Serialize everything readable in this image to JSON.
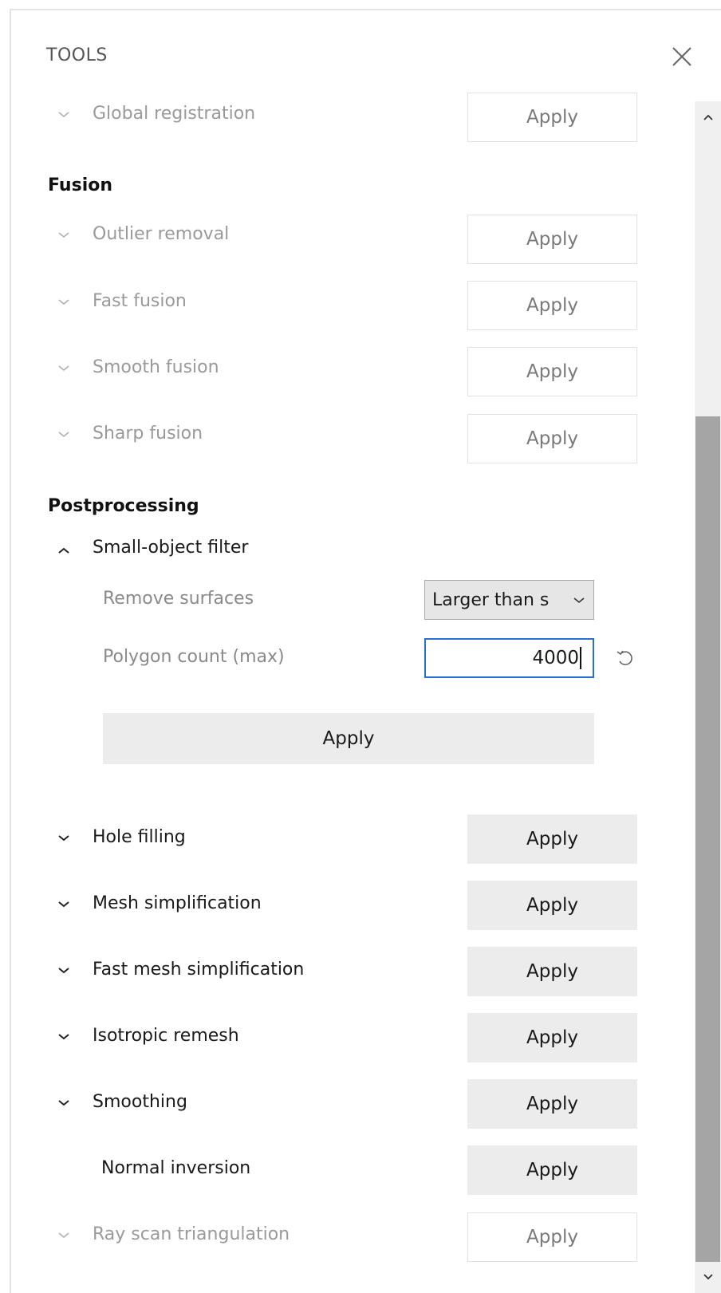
{
  "header": {
    "title": "TOOLS",
    "close_icon": "close-icon"
  },
  "registration": {
    "items": [
      {
        "label": "Global registration",
        "apply": "Apply"
      }
    ]
  },
  "fusion": {
    "title": "Fusion",
    "items": [
      {
        "label": "Outlier removal",
        "apply": "Apply"
      },
      {
        "label": "Fast fusion",
        "apply": "Apply"
      },
      {
        "label": "Smooth fusion",
        "apply": "Apply"
      },
      {
        "label": "Sharp fusion",
        "apply": "Apply"
      }
    ]
  },
  "postprocessing": {
    "title": "Postprocessing",
    "small_object_filter": {
      "label": "Small-object filter",
      "remove_surfaces_label": "Remove surfaces",
      "remove_surfaces_value": "Larger than s",
      "polygon_count_label": "Polygon count (max)",
      "polygon_count_value": "4000",
      "apply": "Apply"
    },
    "items": [
      {
        "label": "Hole filling",
        "apply": "Apply"
      },
      {
        "label": "Mesh simplification",
        "apply": "Apply"
      },
      {
        "label": "Fast mesh simplification",
        "apply": "Apply"
      },
      {
        "label": "Isotropic remesh",
        "apply": "Apply"
      },
      {
        "label": "Smoothing",
        "apply": "Apply"
      },
      {
        "label": "Normal inversion",
        "apply": "Apply"
      },
      {
        "label": "Ray scan triangulation",
        "apply": "Apply"
      }
    ]
  },
  "colors": {
    "accent": "#2a6fd6",
    "disabled_text": "#9a9a9a",
    "button_fill": "#ececec",
    "scroll_thumb": "#a5a5a5"
  }
}
